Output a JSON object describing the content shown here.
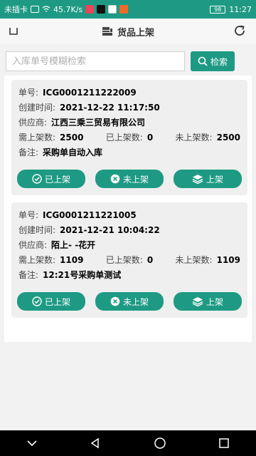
{
  "status": {
    "carrier": "未插卡",
    "speed": "45.7K/s",
    "battery": "98",
    "time": "11:27"
  },
  "header": {
    "title": "货品上架"
  },
  "search": {
    "placeholder": "入库单号模糊检索",
    "value": "",
    "button_label": "检索"
  },
  "labels": {
    "order_no": "单号:",
    "created": "创建时间:",
    "supplier": "供应商:",
    "need": "需上架数:",
    "done": "已上架数:",
    "left": "未上架数:",
    "remark": "备注:"
  },
  "actions": {
    "shelved": "已上架",
    "unshelved": "未上架",
    "shelve": "上架"
  },
  "records": [
    {
      "order_no": "ICG0001211222009",
      "created": "2021-12-22 11:17:50",
      "supplier": "江西三乘三贸易有限公司",
      "need": "2500",
      "done": "0",
      "left": "2500",
      "remark": "采购单自动入库"
    },
    {
      "order_no": "ICG0001211221005",
      "created": "2021-12-21 10:04:22",
      "supplier": "陌上- -花开",
      "need": "1109",
      "done": "0",
      "left": "1109",
      "remark": "12:21号采购单测试"
    }
  ],
  "colors": {
    "accent": "#1e9a84",
    "card_bg": "#efefef"
  }
}
